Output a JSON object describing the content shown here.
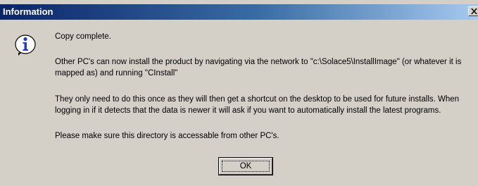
{
  "window": {
    "title": "Information",
    "close_label": "×"
  },
  "icon": {
    "name": "information-icon",
    "glyph": "i"
  },
  "message": {
    "line1": "Copy complete.",
    "para2": "Other PC's can now install the product by navigating via the network to \"c:\\Solace5\\InstallImage\" (or whatever it is mapped as) and running \"CInstall\"",
    "para3": "They only need to do this once as they will then get a shortcut on the desktop to be used for future installs.  When logging in if it detects that the data is newer it will ask if you want to automatically install the latest programs.",
    "para4": "Please make sure this directory is accessable from other PC's."
  },
  "buttons": {
    "ok_label": "OK"
  },
  "colors": {
    "titlebar_start": "#0a246a",
    "titlebar_end": "#a6caf0",
    "dialog_bg": "#d4d0c8",
    "icon_blue": "#1c3cd6"
  }
}
